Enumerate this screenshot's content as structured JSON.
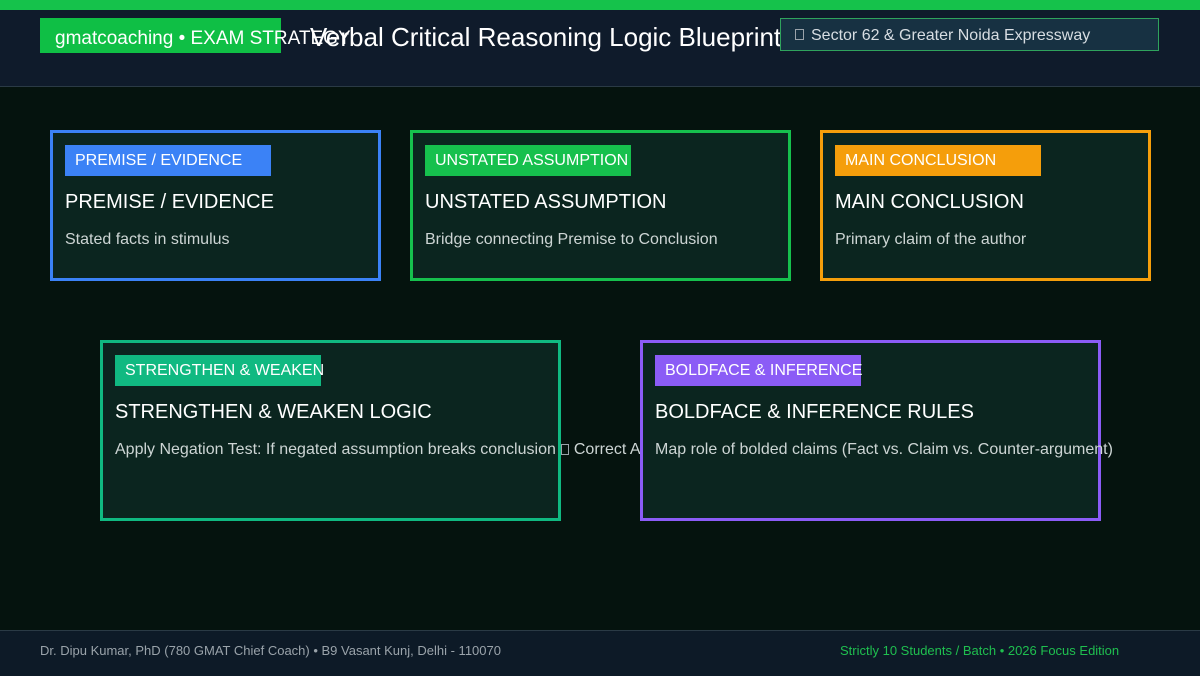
{
  "header": {
    "brand": "gmatcoaching • EXAM STRATEGY",
    "title": "Verbal Critical Reasoning Logic Blueprint",
    "location": "Sector 62 & Greater Noida Expressway",
    "location_icon": "location-icon"
  },
  "cards": [
    {
      "tag": "PREMISE / EVIDENCE",
      "title": "PREMISE / EVIDENCE",
      "desc": "Stated facts in stimulus",
      "color": "#3b82f6"
    },
    {
      "tag": "UNSTATED ASSUMPTION",
      "title": "UNSTATED ASSUMPTION",
      "desc": "Bridge connecting Premise to Conclusion",
      "color": "#16c04d"
    },
    {
      "tag": "MAIN CONCLUSION",
      "title": "MAIN CONCLUSION",
      "desc": "Primary claim of the author",
      "color": "#f59e0b"
    },
    {
      "tag": "STRENGTHEN & WEAKEN",
      "title": "STRENGTHEN & WEAKEN LOGIC",
      "desc_before": "Apply Negation Test: If negated assumption breaks conclusion",
      "desc_after": "Correct A",
      "arrow_icon": "arrow-icon",
      "color": "#10b981"
    },
    {
      "tag": "BOLDFACE & INFERENCE",
      "title": "BOLDFACE & INFERENCE RULES",
      "desc": "Map role of bolded claims (Fact vs. Claim vs. Counter-argument)",
      "color": "#8b5cf6"
    }
  ],
  "footer": {
    "left": "Dr. Dipu Kumar, PhD (780 GMAT Chief Coach) • B9 Vasant Kunj, Delhi - 110070",
    "right": "Strictly 10 Students / Batch • 2026 Focus Edition"
  }
}
